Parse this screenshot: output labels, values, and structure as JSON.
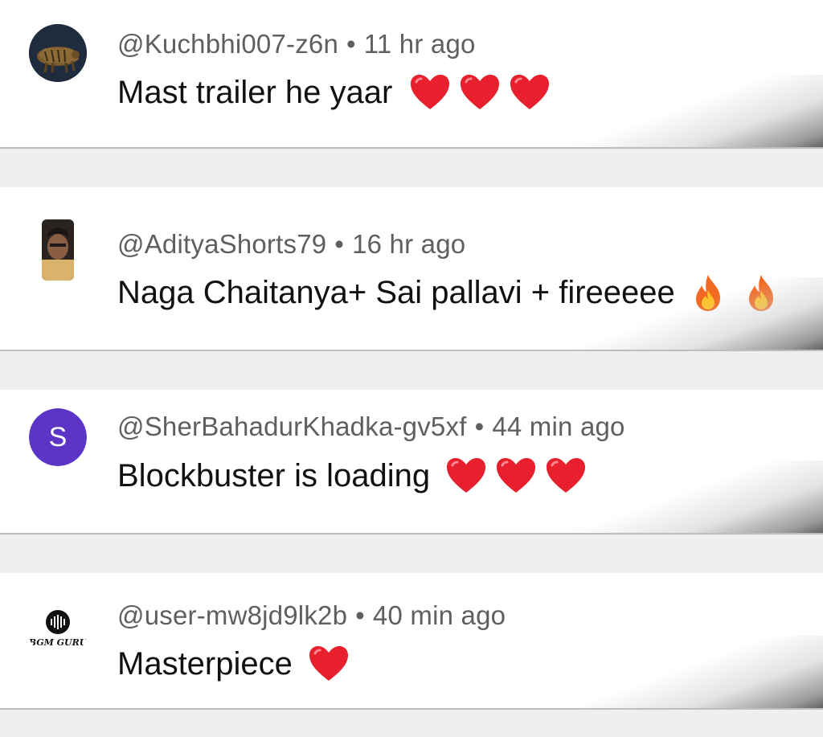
{
  "comments": [
    {
      "username": "@Kuchbhi007-z6n",
      "separator": "•",
      "time": "11 hr ago",
      "text": "Mast trailer he yaar",
      "emojis": [
        "heart",
        "heart",
        "heart"
      ],
      "avatar": "hyena-photo-avatar"
    },
    {
      "username": "@AdityaShorts79",
      "separator": "•",
      "time": "16 hr ago",
      "text": "Naga Chaitanya+ Sai pallavi + fireeeee",
      "emojis": [
        "fire",
        "fire"
      ],
      "avatar": "person-photo-avatar"
    },
    {
      "username": "@SherBahadurKhadka-gv5xf",
      "separator": "•",
      "time": "44 min ago",
      "text": "Blockbuster is loading",
      "emojis": [
        "heart",
        "heart",
        "heart"
      ],
      "avatar_initial": "S",
      "avatar_color": "#5c35c6"
    },
    {
      "username": "@user-mw8jd9lk2b",
      "separator": "•",
      "time": "40 min ago",
      "text": "Masterpiece",
      "emojis": [
        "heart"
      ],
      "avatar_logo_text": "BGM GURU"
    }
  ]
}
